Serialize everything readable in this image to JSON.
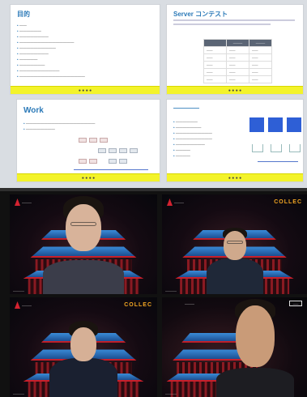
{
  "slides": {
    "slide1": {
      "title": "目的",
      "bullets": [
        "——",
        "——————",
        "————————",
        "———————————————",
        "——————————",
        "————————",
        "—————",
        "———————",
        "———————————",
        "——————————————————"
      ],
      "footer": "● ● ● ●"
    },
    "slide2": {
      "title": "Server コンテスト",
      "header_cols": [
        "",
        "———",
        "———"
      ],
      "rows": [
        [
          "——",
          "——",
          "——"
        ],
        [
          "——",
          "——",
          "——"
        ],
        [
          "——",
          "——",
          "——"
        ],
        [
          "——",
          "——",
          "——"
        ],
        [
          "——",
          "——",
          "——"
        ]
      ],
      "footer": "● ● ● ●"
    },
    "slide3": {
      "title": "Work",
      "bullets": [
        "———————————————————",
        "————————"
      ],
      "footer": "● ● ● ●"
    },
    "slide4": {
      "title": "————",
      "bullets": [
        "——————",
        "———————",
        "——————————",
        "——————————",
        "————————",
        "————",
        "————"
      ],
      "footer": "● ● ● ●"
    }
  },
  "videos": {
    "tile1": {
      "brand": "———",
      "name": "————"
    },
    "tile2": {
      "brand": "———",
      "brand_right": "COLLEC",
      "name": "————"
    },
    "tile3": {
      "brand": "———",
      "brand_right": "COLLEC",
      "name": "————"
    },
    "tile4": {
      "brand": "———",
      "tag": "——",
      "name": "————"
    }
  }
}
